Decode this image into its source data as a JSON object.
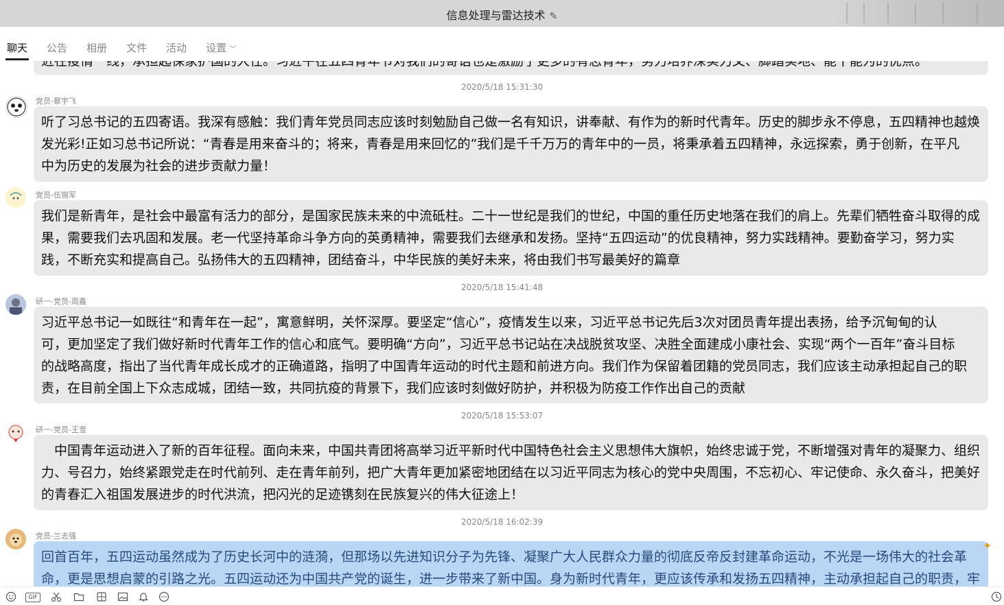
{
  "window": {
    "title": "信息处理与雷达技术"
  },
  "tabs": [
    "聊天",
    "公告",
    "相册",
    "文件",
    "活动",
    "设置"
  ],
  "partial_message": "近在疫情一线，承担起保家护国的大任。习近平在五四青年节对我们的寄语也是激励了更多的有志青年，努力培养深实力文、脚踏实地、能干能为的优点。",
  "messages": [
    {
      "timestamp": "2020/5/18 15:31:30",
      "sender": "党员-蔡宇飞",
      "lines": [
        "听了习总书记的五四寄语。我深有感触：我们青年党员同志应该时刻勉励自己做一名有知识，讲奉献、有作为的新时代青年。历史的脚步永不停息，五四精神也越焕",
        "发光彩!正如习总书记所说：“青春是用来奋斗的；将来，青春是用来回忆的”我们是千千万万的青年中的一员，将秉承着五四精神，永远探索，勇于创新，在平凡",
        "中为历史的发展为社会的进步贡献力量！"
      ]
    },
    {
      "timestamp": "",
      "sender": "党员-伍锡军",
      "lines": [
        "我们是新青年，是社会中最富有活力的部分，是国家民族未来的中流砥柱。二十一世纪是我们的世纪，中国的重任历史地落在我们的肩上。先辈们牺牲奋斗取得的成",
        "果，需要我们去巩固和发展。老一代坚持革命斗争方向的英勇精神，需要我们去继承和发扬。坚持“五四运动”的优良精神，努力实践精神。要勤奋学习，努力实",
        "践，不断充实和提高自己。弘扬伟大的五四精神，团结奋斗，中华民族的美好未来，将由我们书写最美好的篇章"
      ]
    },
    {
      "timestamp": "2020/5/18 15:41:48",
      "sender": "研一-党员-周鑫",
      "lines": [
        "习近平总书记一如既往“和青年在一起”，寓意鲜明，关怀深厚。要坚定“信心”，疫情发生以来，习近平总书记先后3次对团员青年提出表扬，给予沉甸甸的认",
        "可，更加坚定了我们做好新时代青年工作的信心和底气。要明确“方向”，习近平总书记站在决战脱贫攻坚、决胜全面建成小康社会、实现“两个一百年”奋斗目标",
        "的战略高度，指出了当代青年成长成才的正确道路，指明了中国青年运动的时代主题和前进方向。我们作为保留着团籍的党员同志，我们应该主动承担起自己的职",
        "责，在目前全国上下众志成城，团结一致，共同抗疫的背景下，我们应该时刻做好防护，并积极为防疫工作作出自己的贡献"
      ]
    },
    {
      "timestamp": "2020/5/18 15:53:07",
      "sender": "研一-党员-王雪",
      "lines": [
        "　中国青年运动进入了新的百年征程。面向未来，中国共青团将高举习近平新时代中国特色社会主义思想伟大旗帜，始终忠诚于党，不断增强对青年的凝聚力、组织",
        "力、号召力，始终紧跟党走在时代前列、走在青年前列，把广大青年更加紧密地团结在以习近平同志为核心的党中央周围，不忘初心、牢记使命、永久奋斗，把美好",
        "的青春汇入祖国发展进步的时代洪流，把闪光的足迹镌刻在民族复兴的伟大征途上！"
      ]
    },
    {
      "timestamp": "2020/5/18 16:02:39",
      "sender": "党员-兰志强",
      "lines": [
        "回首百年，五四运动虽然成为了历史长河中的涟漪，但那场以先进知识分子为先锋、凝聚广大人民群众力量的彻底反帝反封建革命运动，不光是一场伟大的社会革",
        "命，更是思想启蒙的引路之光。五四运动还为中国共产党的诞生，进一步带来了新中国。身为新时代青年，更应该传承和发扬五四精神，主动承担起自己的职责，牢"
      ]
    }
  ],
  "toolbar": [
    "emoji-icon",
    "gif-icon",
    "scissors-icon",
    "folder-icon",
    "sticker-icon",
    "image-icon",
    "bell-icon",
    "more-icon"
  ]
}
